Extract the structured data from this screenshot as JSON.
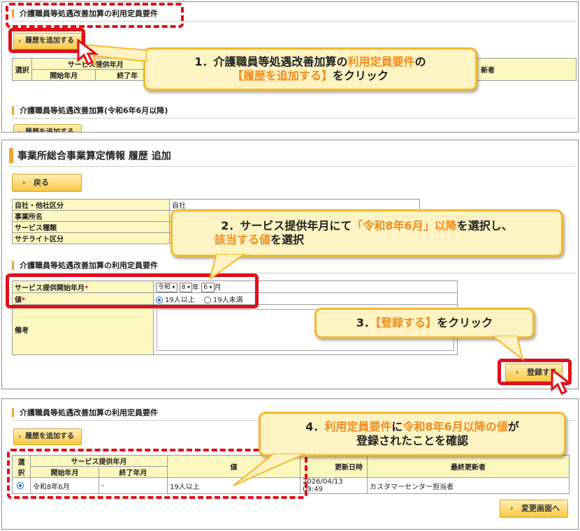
{
  "panel1": {
    "section_title": "介護職員等処遇改善加算の利用定員要件",
    "add_button": "履歴を追加する",
    "table": {
      "select": "選択",
      "service_month": "サービス提供年月",
      "start": "開始年月",
      "end": "終了年",
      "last_updater": "新者"
    },
    "section2_title": "介護職員等処遇改善加算(令和6年6月以降)",
    "add_button2": "履歴を追加する",
    "callout_line1_a": "1．介護職員等処遇改善加算の",
    "callout_line1_b": "利用定員要件",
    "callout_line1_c": "の",
    "callout_line2_a": "【履歴を追加する】",
    "callout_line2_b": "をクリック"
  },
  "panel2": {
    "page_title": "事業所総合事業算定情報 履歴 追加",
    "back_button": "戻る",
    "info_rows": [
      {
        "label": "自社・他社区分",
        "value": "自社"
      },
      {
        "label": "事業所名",
        "value": ""
      },
      {
        "label": "サービス種類",
        "value": ""
      },
      {
        "label": "サテライト区分",
        "value": ""
      }
    ],
    "section_title": "介護職員等処遇改善加算の利用定員要件",
    "start_label": "サービス提供開始年月",
    "value_label": "値",
    "required_mark": "*",
    "era": "令和",
    "year": "8",
    "year_unit": "年",
    "month": "6",
    "month_unit": "月",
    "radio_option1": "19人以上",
    "radio_option2": "19人未満",
    "remarks_label": "備考",
    "register_button": "登録する",
    "callout2_line1_a": "2．サービス提供年月にて",
    "callout2_line1_b": "「令和8年6月」以降",
    "callout2_line1_c": "を選択し、",
    "callout2_line2_a": "該当する値",
    "callout2_line2_b": "を選択",
    "callout3_a": "3．",
    "callout3_b": "【登録する】",
    "callout3_c": "をクリック"
  },
  "panel3": {
    "section_title": "介護職員等処遇改善加算の利用定員要件",
    "add_button": "履歴を追加する",
    "table": {
      "select": "選択",
      "service_month": "サービス提供年月",
      "start": "開始年月",
      "end": "終了年月",
      "value": "値",
      "updated_at": "最終更新日時",
      "updated_at_visible": "更新日時",
      "last_updater": "最終更新者"
    },
    "row": {
      "start": "令和8年6月",
      "end": "-",
      "value": "19人以上",
      "updated_at": "2026/04/13 09:49",
      "updater": "カスタマーセンター担当者"
    },
    "change_button": "変更画面へ",
    "callout4_line1_a": "4．",
    "callout4_line1_b": "利用定員要件",
    "callout4_line1_c": "に",
    "callout4_line1_d": "令和8年6月以降の値",
    "callout4_line1_e": "が",
    "callout4_line2": "登録されたことを確認"
  },
  "colors": {
    "accent_red": "#e0101c",
    "callout_fill": "#fef3c2",
    "callout_border": "#f5b829",
    "highlight_text": "#f08c1e",
    "header_fill": "#fdf8c0",
    "button_fill": "#f7c844"
  }
}
